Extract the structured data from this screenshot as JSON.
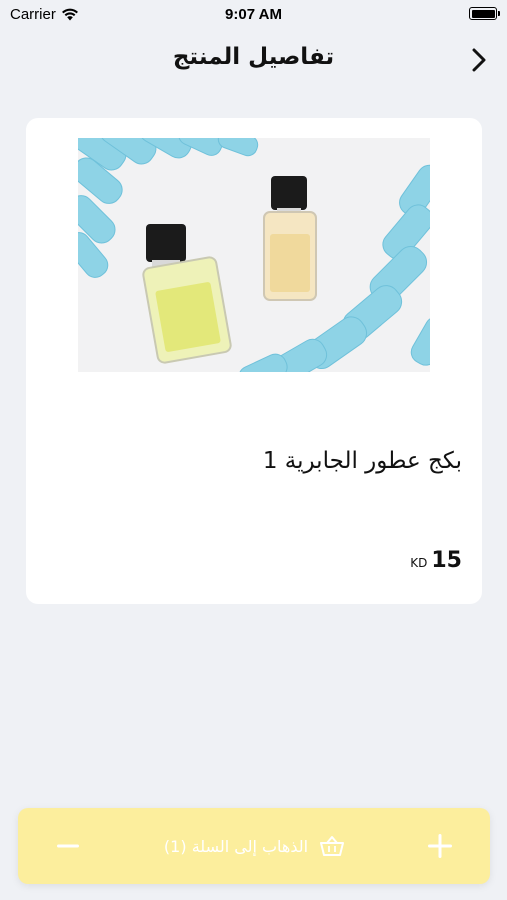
{
  "status_bar": {
    "carrier": "Carrier",
    "time": "9:07 AM"
  },
  "nav": {
    "title": "تفاصيل المنتج",
    "back_icon": "chevron-right-icon"
  },
  "product": {
    "name": "بكج عطور الجابرية 1",
    "price_amount": "15",
    "currency": "KD"
  },
  "cart_bar": {
    "label": "الذهاب إلى السلة (1)",
    "minus_icon": "minus-icon",
    "plus_icon": "plus-icon",
    "basket_icon": "basket-icon"
  },
  "colors": {
    "background": "#eff1f5",
    "card": "#ffffff",
    "cart_bar": "#fcee9d",
    "cart_bar_text": "#ffffff"
  }
}
